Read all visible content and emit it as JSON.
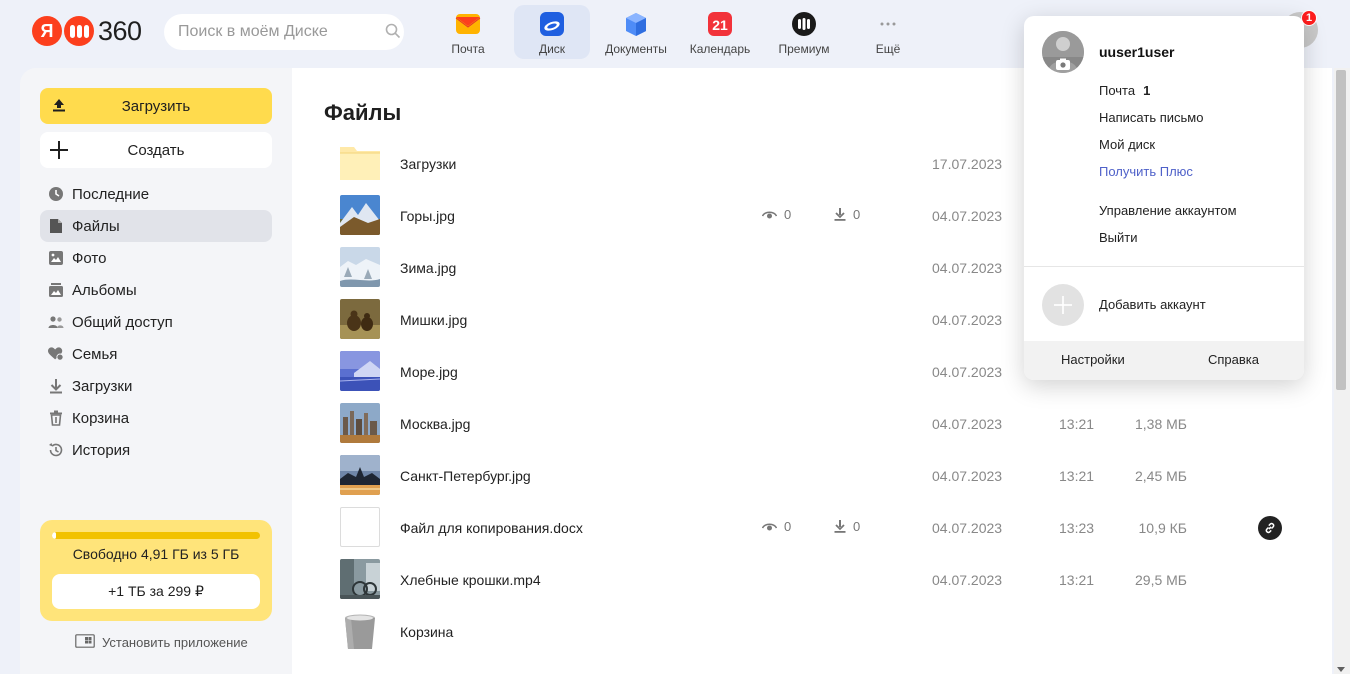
{
  "colors": {
    "accent_yellow": "#ffdb4d",
    "brand_red": "#fc3f1d",
    "link_blue": "#4f61c9",
    "badge_red": "#ff1e1e"
  },
  "header": {
    "logo_letter": "Я",
    "logo_text": "360",
    "search_placeholder": "Поиск в моём Диске",
    "apps": [
      {
        "name": "mail",
        "label": "Почта",
        "icon": "mail-icon"
      },
      {
        "name": "disk",
        "label": "Диск",
        "icon": "disk-icon",
        "active": true
      },
      {
        "name": "docs",
        "label": "Документы",
        "icon": "documents-icon"
      },
      {
        "name": "calendar",
        "label": "Календарь",
        "icon": "calendar-icon",
        "day": "21"
      },
      {
        "name": "premium",
        "label": "Премиум",
        "icon": "premium-icon"
      },
      {
        "name": "more",
        "label": "Ещё",
        "icon": "more-dots-icon"
      }
    ],
    "notification_count": "1"
  },
  "sidebar": {
    "upload_label": "Загрузить",
    "create_label": "Создать",
    "items": [
      {
        "label": "Последние",
        "icon": "clock-icon"
      },
      {
        "label": "Файлы",
        "icon": "file-icon",
        "active": true
      },
      {
        "label": "Фото",
        "icon": "photo-icon"
      },
      {
        "label": "Альбомы",
        "icon": "albums-icon"
      },
      {
        "label": "Общий доступ",
        "icon": "shared-icon"
      },
      {
        "label": "Семья",
        "icon": "family-icon"
      },
      {
        "label": "Загрузки",
        "icon": "download-icon"
      },
      {
        "label": "Корзина",
        "icon": "trash-icon"
      },
      {
        "label": "История",
        "icon": "history-icon"
      }
    ],
    "storage": {
      "used_fraction": 0.018,
      "text": "Свободно 4,91 ГБ из 5 ГБ",
      "upgrade_label": "+1 ТБ за 299 ₽"
    },
    "install_app_label": "Установить приложение"
  },
  "main": {
    "title": "Файлы",
    "files": [
      {
        "name": "Загрузки",
        "type": "folder",
        "date": "17.07.2023",
        "time": "",
        "size": ""
      },
      {
        "name": "Горы.jpg",
        "type": "image-mountains",
        "views": "0",
        "downloads": "0",
        "date": "04.07.2023",
        "time": "",
        "size": ""
      },
      {
        "name": "Зима.jpg",
        "type": "image-winter",
        "date": "04.07.2023",
        "time": "",
        "size": ""
      },
      {
        "name": "Мишки.jpg",
        "type": "image-bears",
        "date": "04.07.2023",
        "time": "",
        "size": ""
      },
      {
        "name": "Море.jpg",
        "type": "image-sea",
        "date": "04.07.2023",
        "time": "",
        "size": ""
      },
      {
        "name": "Москва.jpg",
        "type": "image-moscow",
        "date": "04.07.2023",
        "time": "13:21",
        "size": "1,38 МБ"
      },
      {
        "name": "Санкт-Петербург.jpg",
        "type": "image-spb",
        "date": "04.07.2023",
        "time": "13:21",
        "size": "2,45 МБ"
      },
      {
        "name": "Файл для копирования.docx",
        "type": "document",
        "views": "0",
        "downloads": "0",
        "date": "04.07.2023",
        "time": "13:23",
        "size": "10,9 КБ",
        "shared": true
      },
      {
        "name": "Хлебные крошки.mp4",
        "type": "video",
        "date": "04.07.2023",
        "time": "13:21",
        "size": "29,5 МБ"
      },
      {
        "name": "Корзина",
        "type": "trash",
        "date": "",
        "time": "",
        "size": ""
      }
    ]
  },
  "account_popup": {
    "username": "uuser1user",
    "mail_label": "Почта",
    "mail_count": "1",
    "write_label": "Написать письмо",
    "disk_label": "Мой диск",
    "plus_label": "Получить Плюс",
    "manage_label": "Управление аккаунтом",
    "logout_label": "Выйти",
    "add_account_label": "Добавить аккаунт",
    "settings_label": "Настройки",
    "help_label": "Справка"
  }
}
